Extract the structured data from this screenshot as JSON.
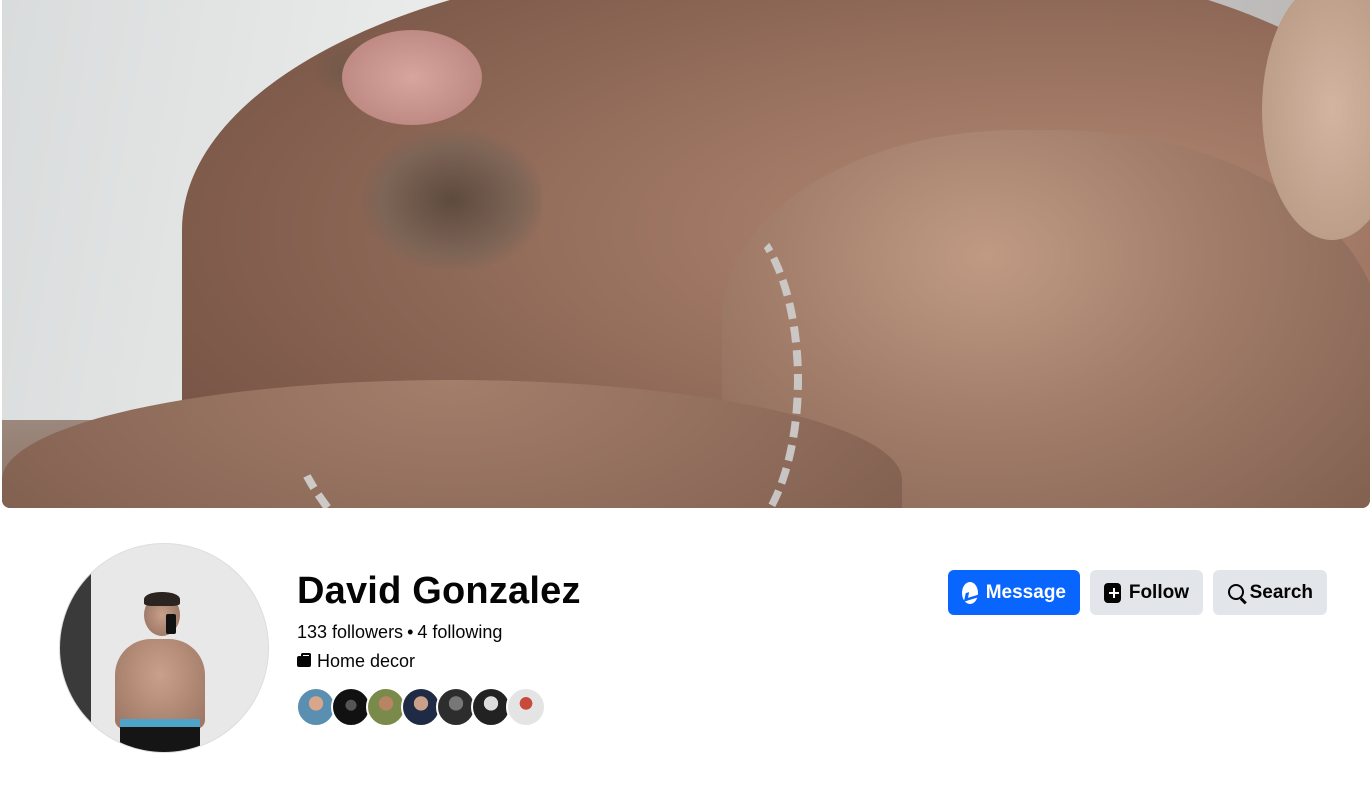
{
  "profile": {
    "name": "David Gonzalez",
    "followers": "133 followers",
    "separator": "•",
    "following": "4 following",
    "category": "Home decor"
  },
  "actions": {
    "message_label": "Message",
    "follow_label": "Follow",
    "search_label": "Search"
  },
  "friends": {
    "count_shown": 7
  },
  "colors": {
    "primary": "#0866ff",
    "secondary_button": "#e2e5e9",
    "text": "#050505"
  },
  "icons": [
    "messenger-icon",
    "follow-icon",
    "search-icon",
    "category-icon"
  ]
}
